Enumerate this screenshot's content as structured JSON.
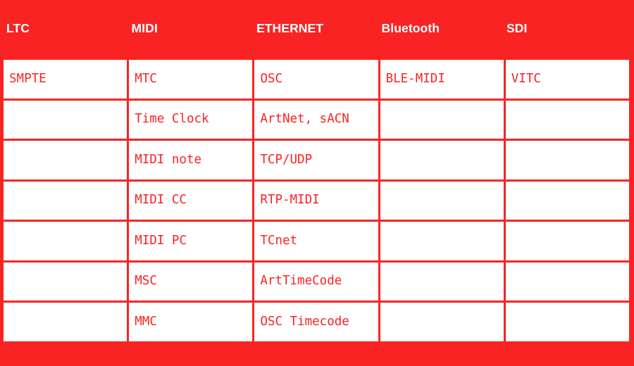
{
  "colors": {
    "brand_red": "#FA2323",
    "cell_background": "#FFFFFF",
    "header_text": "#FFFFFF",
    "body_text": "#FA2323"
  },
  "table": {
    "headers": [
      {
        "label": "LTC"
      },
      {
        "label": "MIDI"
      },
      {
        "label": "ETHERNET"
      },
      {
        "label": "Bluetooth"
      },
      {
        "label": "SDI"
      }
    ],
    "rows": [
      {
        "cells": [
          "SMPTE",
          "MTC",
          "OSC",
          "BLE-MIDI",
          "VITC"
        ]
      },
      {
        "cells": [
          "",
          "Time Clock",
          "ArtNet, sACN",
          "",
          ""
        ]
      },
      {
        "cells": [
          "",
          "MIDI note",
          "TCP/UDP",
          "",
          ""
        ]
      },
      {
        "cells": [
          "",
          "MIDI CC",
          "RTP-MIDI",
          "",
          ""
        ]
      },
      {
        "cells": [
          "",
          "MIDI PC",
          "TCnet",
          "",
          ""
        ]
      },
      {
        "cells": [
          "",
          "MSC",
          "ArtTimeCode",
          "",
          ""
        ]
      },
      {
        "cells": [
          "",
          "MMC",
          "OSC Timecode",
          "",
          ""
        ]
      }
    ],
    "columns": {
      "LTC": [
        "SMPTE"
      ],
      "MIDI": [
        "MTC",
        "Time Clock",
        "MIDI note",
        "MIDI CC",
        "MIDI PC",
        "MSC",
        "MMC"
      ],
      "ETHERNET": [
        "OSC",
        "ArtNet, sACN",
        "TCP/UDP",
        "RTP-MIDI",
        "TCnet",
        "ArtTimeCode",
        "OSC Timecode"
      ],
      "Bluetooth": [
        "BLE-MIDI"
      ],
      "SDI": [
        "VITC"
      ]
    },
    "row_count": 7,
    "column_count": 5
  }
}
